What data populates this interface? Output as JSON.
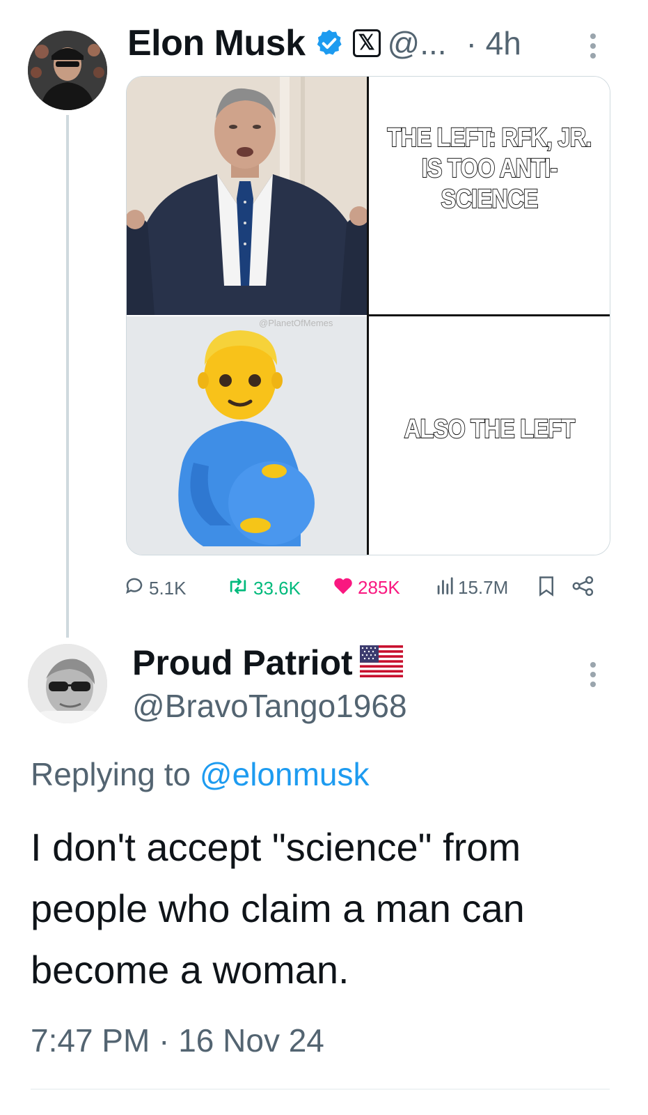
{
  "parent_tweet": {
    "author_name": "Elon Musk",
    "handle": "@...",
    "time": "· 4h",
    "image": {
      "top_right_text": "THE LEFT: RFK, JR. IS TOO ANTI-SCIENCE",
      "bottom_right_text": "ALSO THE LEFT",
      "watermark": "@PlanetOfMemes"
    },
    "stats": {
      "replies": "5.1K",
      "reposts": "33.6K",
      "likes": "285K",
      "views": "15.7M"
    }
  },
  "reply_tweet": {
    "author_name": "Proud Patriot",
    "handle": "@BravoTango1968",
    "replying_prefix": "Replying to",
    "replying_to": "@elonmusk",
    "text": "I don't accept \"science\" from people who claim a man can become a woman.",
    "timestamp": "7:47 PM · 16 Nov 24"
  },
  "colors": {
    "verified_blue": "#1d9bf0",
    "like_pink": "#f91880",
    "repost_green": "#00ba7c",
    "secondary_text": "#536471"
  },
  "icons": [
    "verified-badge-icon",
    "x-logo-icon",
    "more-options-icon",
    "reply-icon",
    "repost-icon",
    "like-icon",
    "views-icon",
    "bookmark-icon",
    "share-icon",
    "us-flag-icon"
  ]
}
